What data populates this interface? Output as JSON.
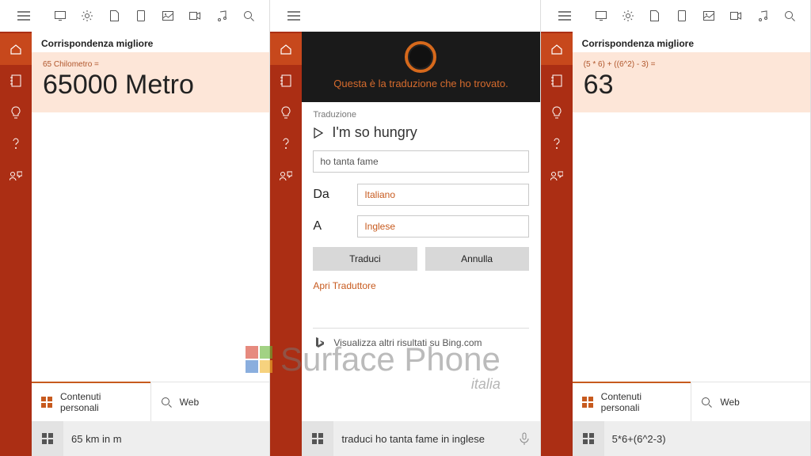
{
  "panel1": {
    "section_title": "Corrispondenza migliore",
    "card_sub": "65 Chilometro =",
    "card_big": "65000 Metro",
    "tab_personal": "Contenuti personali",
    "tab_web": "Web",
    "search_value": "65 km in m"
  },
  "panel2": {
    "cortana_text": "Questa è la traduzione che ho trovato.",
    "trans_label": "Traduzione",
    "trans_result": "I'm so hungry",
    "trans_input": "ho tanta fame",
    "from_label": "Da",
    "to_label": "A",
    "from_lang": "Italiano",
    "to_lang": "Inglese",
    "btn_translate": "Traduci",
    "btn_cancel": "Annulla",
    "open_translator": "Apri Traduttore",
    "bing_text": "Visualizza altri risultati su Bing.com",
    "search_value": "traduci ho tanta fame in inglese"
  },
  "panel3": {
    "section_title": "Corrispondenza migliore",
    "card_sub": "(5 * 6) + ((6^2) - 3) =",
    "card_big": "63",
    "tab_personal": "Contenuti personali",
    "tab_web": "Web",
    "search_value": "5*6+(6^2-3)"
  },
  "watermark": {
    "text": "Surface Phone",
    "sub": "italia"
  }
}
